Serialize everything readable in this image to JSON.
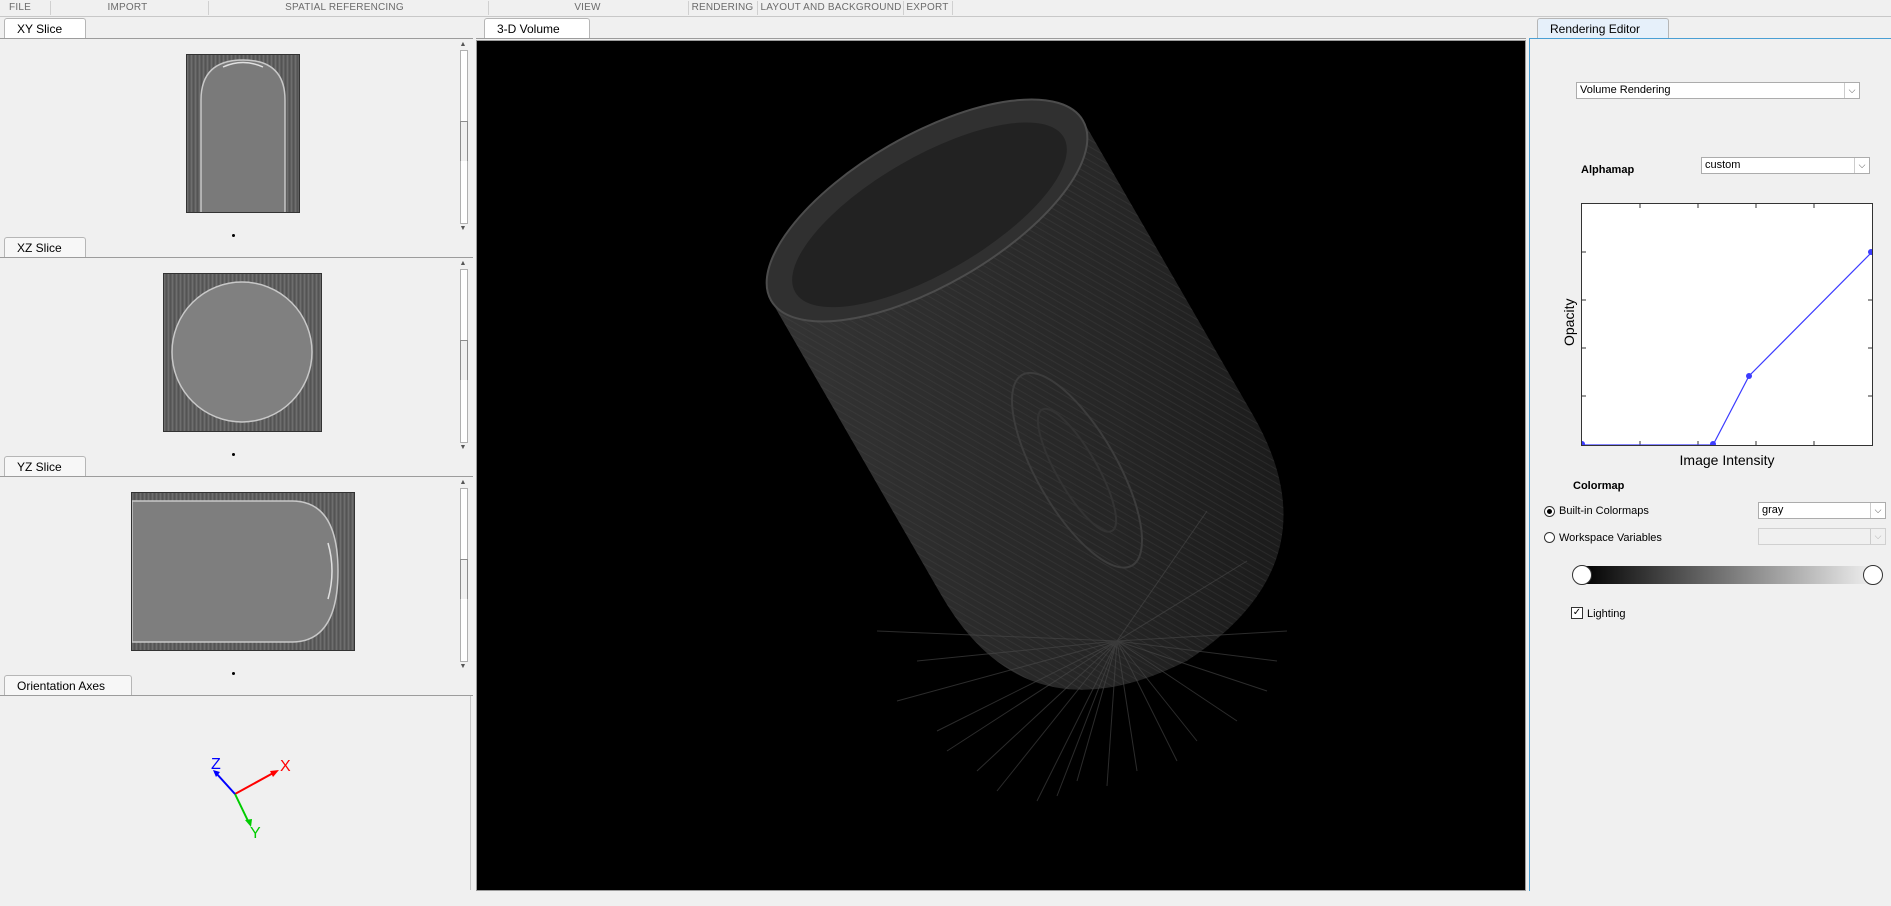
{
  "toolstrip": {
    "sections": [
      "FILE",
      "IMPORT",
      "SPATIAL REFERENCING",
      "VIEW",
      "RENDERING",
      "LAYOUT AND BACKGROUND",
      "EXPORT"
    ]
  },
  "left_panels": {
    "xy_tab": "XY Slice",
    "xz_tab": "XZ Slice",
    "yz_tab": "YZ Slice",
    "axes_tab": "Orientation Axes",
    "axes_labels": {
      "x": "X",
      "y": "Y",
      "z": "Z"
    }
  },
  "volume": {
    "tab": "3-D Volume"
  },
  "rendering_editor": {
    "tab": "Rendering Editor",
    "style_dropdown": "Volume Rendering",
    "alphamap_label": "Alphamap",
    "alphamap_dropdown": "custom",
    "plot_ylabel": "Opacity",
    "plot_xlabel": "Image Intensity",
    "colormap_label": "Colormap",
    "builtin_label": "Built-in Colormaps",
    "builtin_selected": true,
    "builtin_dropdown": "gray",
    "workspace_label": "Workspace Variables",
    "workspace_dropdown": "",
    "lighting_label": "Lighting",
    "lighting_checked": true
  },
  "colors": {
    "accent": "#4a9fd4",
    "curve": "#3c3cff",
    "axis_x": "#ff0000",
    "axis_y": "#00cc00",
    "axis_z": "#0000ff"
  }
}
